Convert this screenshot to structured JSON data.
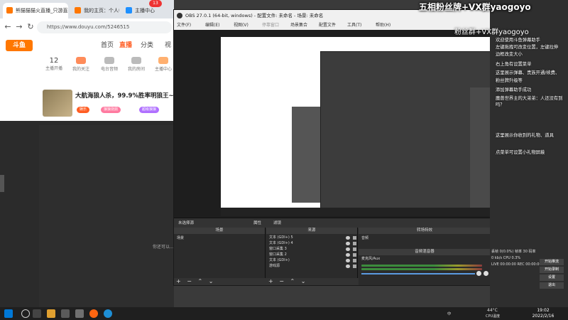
{
  "browser": {
    "tabs": [
      {
        "label": "熊猫猫猫火直播_只游直播_斗鱼",
        "color": "#ff7700"
      },
      {
        "label": "我的主页：个人中心 - 斗鱼",
        "color": "#ff7700"
      },
      {
        "label": "主播中心",
        "color": "#1e90ff"
      }
    ],
    "tab_badge": "13",
    "url": "https://www.douyu.com/5246515",
    "site": {
      "logo": "斗鱼",
      "nav": [
        "首页",
        "直播",
        "分类"
      ],
      "nav_more": "视"
    },
    "stats": [
      {
        "value": "12",
        "label": "主播开播"
      },
      {
        "value": "",
        "label": "我的关注"
      },
      {
        "value": "",
        "label": "电台音频"
      },
      {
        "value": "",
        "label": "我的房间"
      },
      {
        "value": "",
        "label": "主播中心"
      }
    ],
    "room": {
      "title": "大航海狼人杀，99.9%胜率明狼王~！",
      "tags": [
        "娱乐",
        "狼狼烧鼎",
        "超级狼狼"
      ]
    },
    "video_note": "你还可以..."
  },
  "obs": {
    "title": "OBS 27.0.1 (64-bit, windows) - 配置文件: 未命名 - 场景: 未命名",
    "menu": [
      "文件(F)",
      "编辑(E)",
      "视图(V)",
      "停靠窗口",
      "场景集合",
      "配置文件",
      "工具(T)",
      "帮助(H)"
    ],
    "mode_label": "未选择源",
    "mode_buttons": [
      "属性",
      "滤镜"
    ],
    "panes": {
      "scenes": {
        "header": "场景",
        "items": [
          "场景"
        ]
      },
      "sources": {
        "header": "来源",
        "items": [
          "文本 (GDI+) 5",
          "文本 (GDI+) 4",
          "窗口采集 3",
          "窗口采集 2",
          "文本 (GDI+)",
          "游戏源"
        ]
      },
      "mixer": {
        "header": "音频混音器",
        "track1": "音频",
        "track2": "麦克风/Aux"
      },
      "transitions": {
        "header": "转场特效"
      }
    },
    "footer_controls": "+ − ⌃ ⌄",
    "status": {
      "live": "LIVE: 00:00:00",
      "rec": "REC: 00:00:00",
      "cpu": "CPU: 0.5%, 60.00 fps"
    }
  },
  "overlay": {
    "banner": "五相粉丝牌+VX群yaogoyo",
    "banner2": "粉丝群+VX群yaogoyo",
    "chat": [
      "欢迎使用斗鱼弹幕助手",
      "左键拖拽可改变位置，左键拉伸",
      "边框改变大小",
      "右上角有设置菜单",
      "这里展示弹幕、贵族开通/续费、",
      "粉丝牌升级等",
      "添加弹幕助手成功",
      "魔兽世界主的大弟弟：人还没有到吗？",
      "这里展示你收到的礼物、道具",
      "点菜单可设置小礼物屏蔽"
    ],
    "stats_lines": [
      "丢帧 0(0.0%) 帧率 30  码率",
      "0 kb/s  CPU 0.3%",
      "LIVE 00:00:00  REC 00:00:00"
    ],
    "buttons": [
      "开始推流",
      "开始录制",
      "设置",
      "退出"
    ]
  },
  "taskbar": {
    "weather": "44°C",
    "weather_label": "CPU温度",
    "time": "19:02",
    "date": "2022/2/16",
    "lang": "中"
  }
}
